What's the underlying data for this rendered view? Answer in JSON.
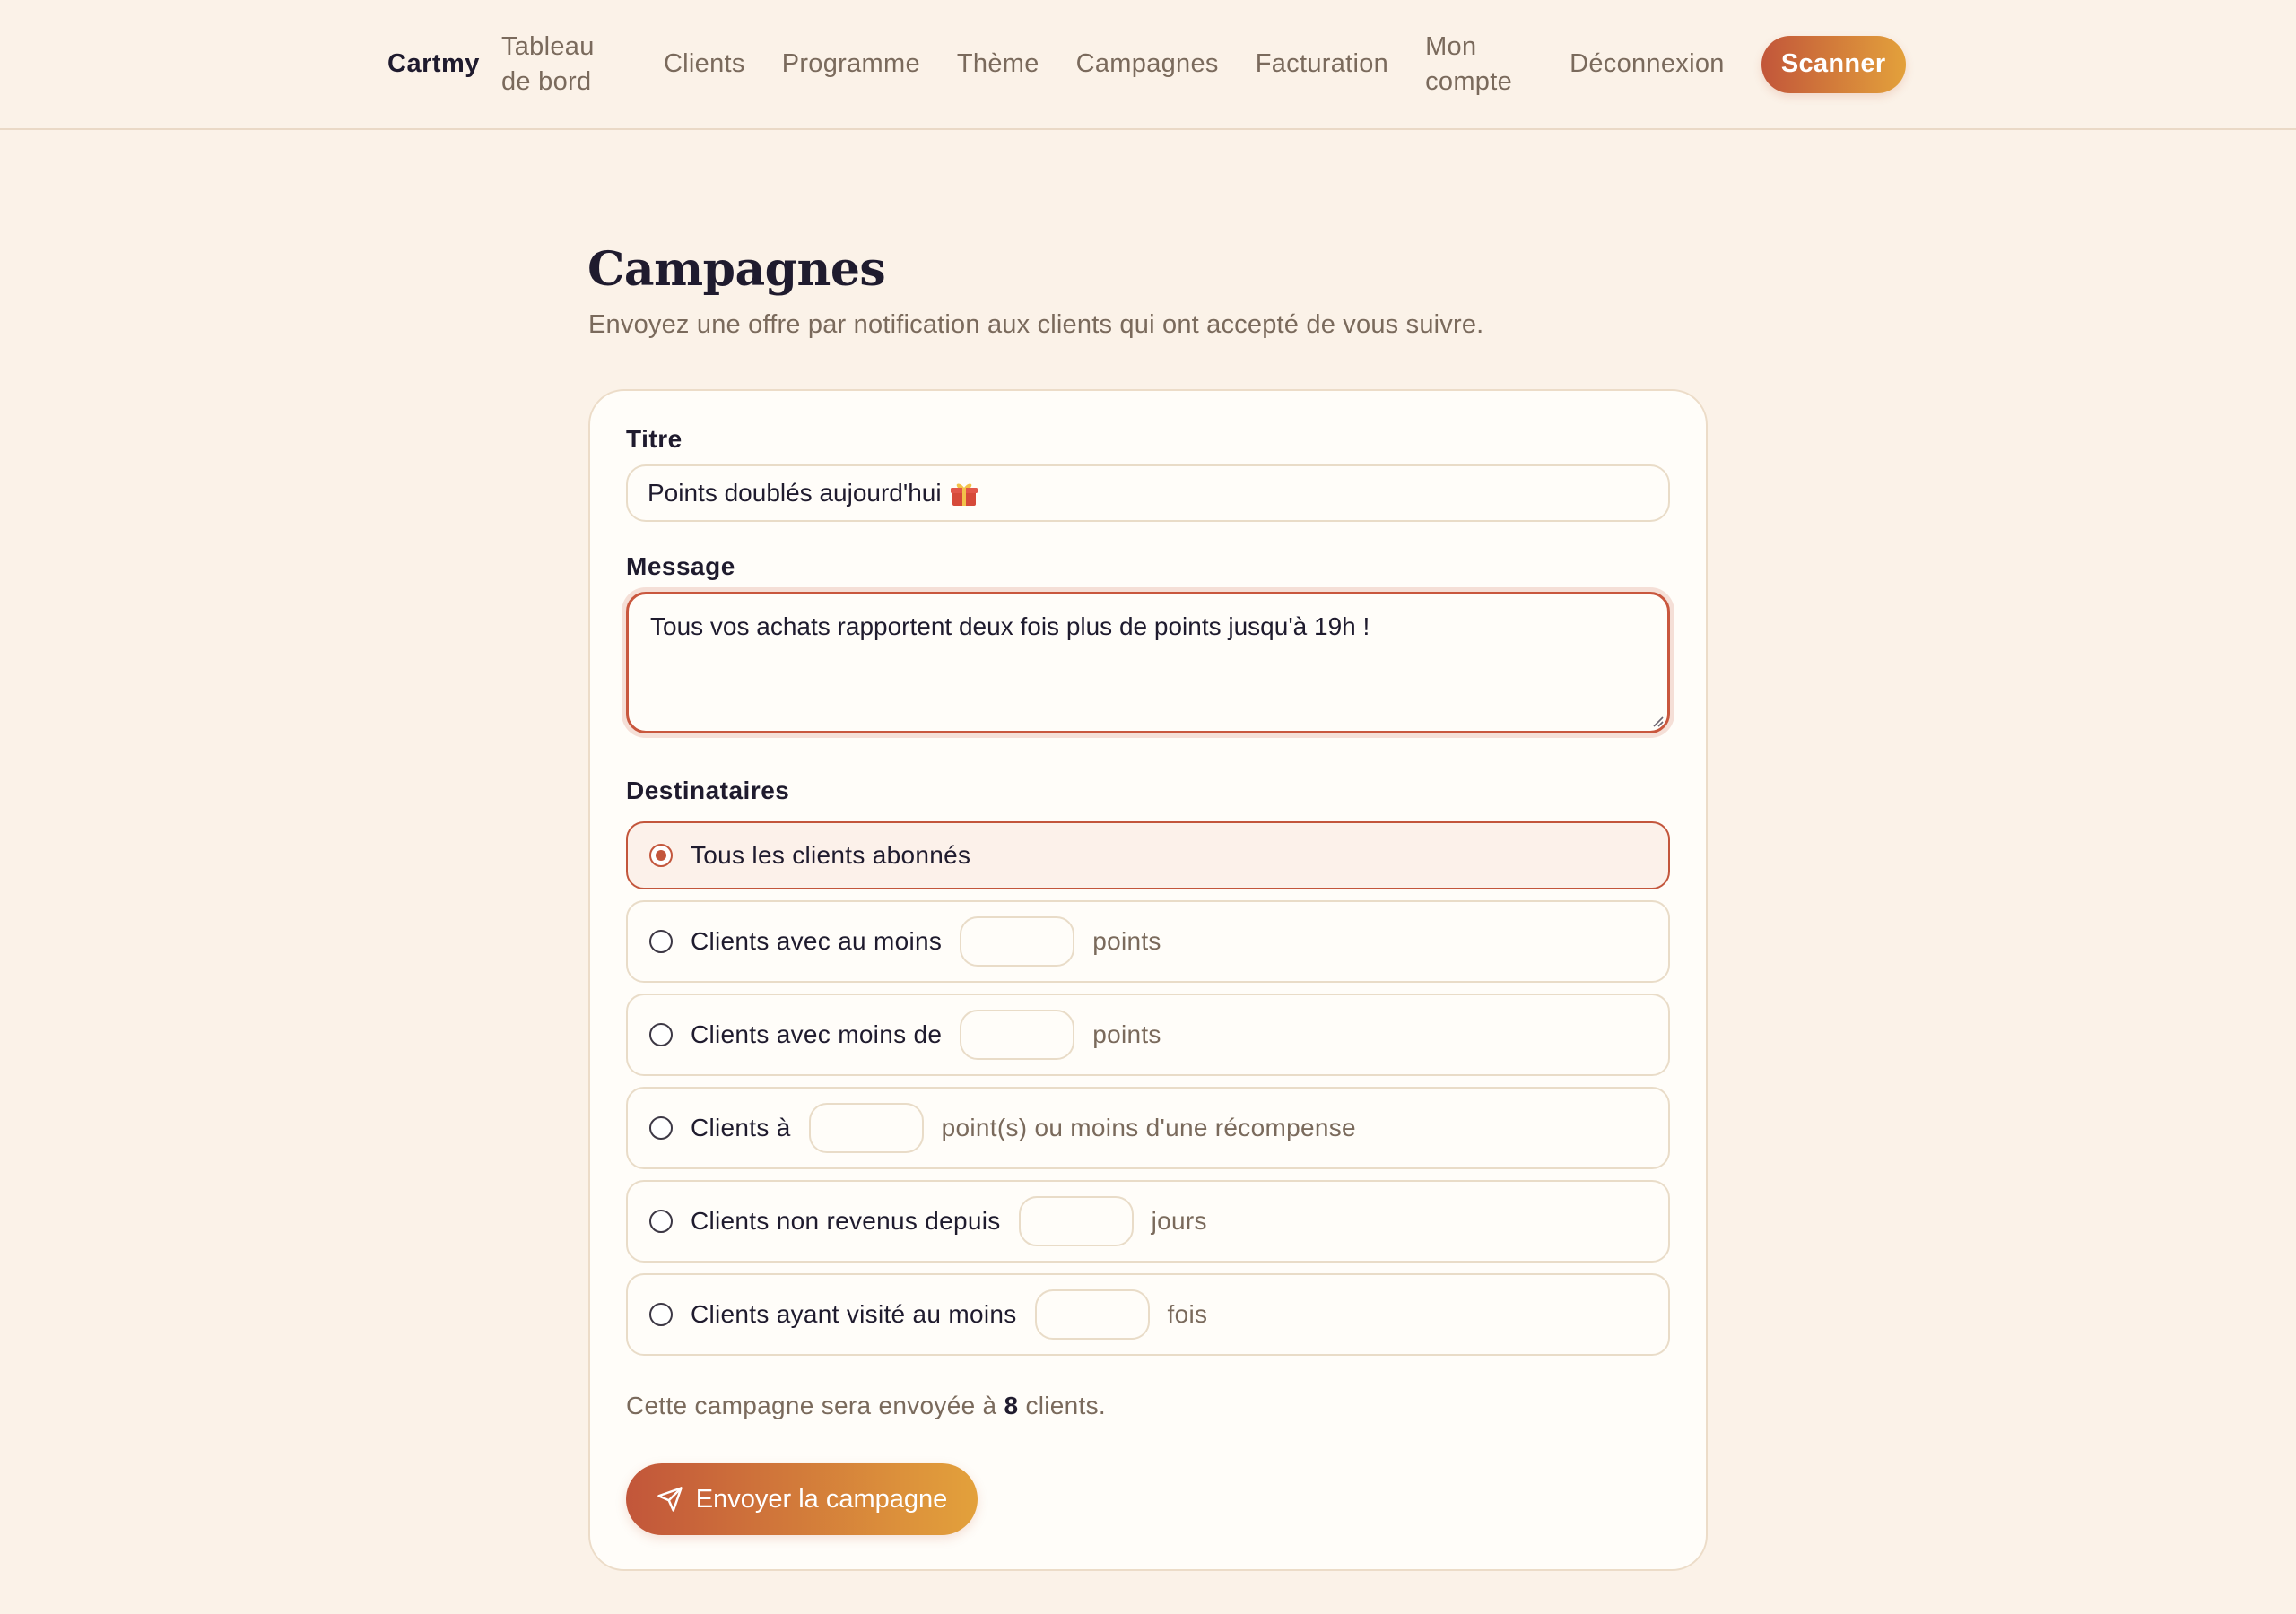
{
  "nav": {
    "brand": "Cartmy",
    "links": [
      "Tableau de bord",
      "Clients",
      "Programme",
      "Thème",
      "Campagnes",
      "Facturation",
      "Mon compte",
      "Déconnexion"
    ],
    "scan_label": "Scanner"
  },
  "page": {
    "title": "Campagnes",
    "subtitle": "Envoyez une offre par notification aux clients qui ont accepté de vous suivre."
  },
  "form": {
    "title_label": "Titre",
    "title_value": "Points doublés aujourd'hui",
    "title_emoji_icon": "gift-icon",
    "message_label": "Message",
    "message_value": "Tous vos achats rapportent deux fois plus de points jusqu'à 19h !",
    "recipients_label": "Destinataires",
    "options": [
      {
        "label": "Tous les clients abonnés",
        "selected": true
      },
      {
        "label": "Clients avec au moins",
        "unit": "points",
        "selected": false
      },
      {
        "label": "Clients avec moins de",
        "unit": "points",
        "selected": false
      },
      {
        "label": "Clients à",
        "unit": "point(s) ou moins d'une récompense",
        "selected": false
      },
      {
        "label": "Clients non revenus depuis",
        "unit": "jours",
        "selected": false
      },
      {
        "label": "Clients ayant visité au moins",
        "unit": "fois",
        "selected": false
      }
    ],
    "summary_prefix": "Cette campagne sera envoyée à",
    "summary_count": "8",
    "summary_suffix": "clients.",
    "send_label": "Envoyer la campagne",
    "send_icon": "send-icon"
  },
  "colors": {
    "background": "#fbf2e8",
    "accent_start": "#c2563a",
    "accent_end": "#e3a13b",
    "text": "#1f1b2e",
    "muted": "#7a6a5c"
  }
}
